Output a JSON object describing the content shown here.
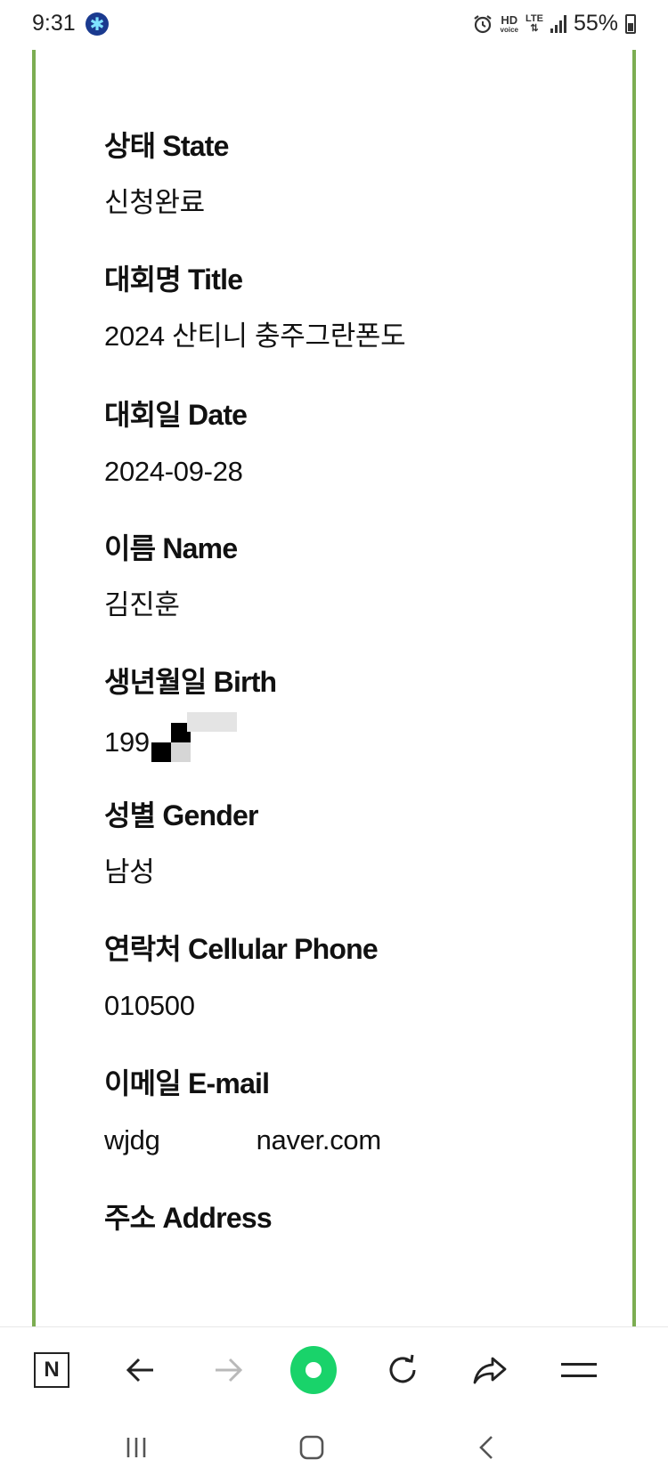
{
  "status_bar": {
    "time": "9:31",
    "battery_text": "55%",
    "hd_label": "HD",
    "voice_label": "voice",
    "lte_label": "LTE"
  },
  "fields": [
    {
      "label": "상태 State",
      "value": "신청완료"
    },
    {
      "label": "대회명 Title",
      "value": "2024 산티니 충주그란폰도"
    },
    {
      "label": "대회일 Date",
      "value": "2024-09-28"
    },
    {
      "label": "이름 Name",
      "value": "김진훈"
    },
    {
      "label": "생년월일 Birth",
      "value": "199"
    },
    {
      "label": "성별 Gender",
      "value": "남성"
    },
    {
      "label": "연락처 Cellular Phone",
      "value": "010500"
    },
    {
      "label": "이메일 E-mail",
      "value_start": "wjdg",
      "value_end": "naver.com"
    },
    {
      "label": "주소 Address",
      "value": ""
    }
  ],
  "toolbar": {
    "naver_label": "N"
  },
  "colors": {
    "frame_border": "#7cad52",
    "green_button": "#19d36a"
  }
}
